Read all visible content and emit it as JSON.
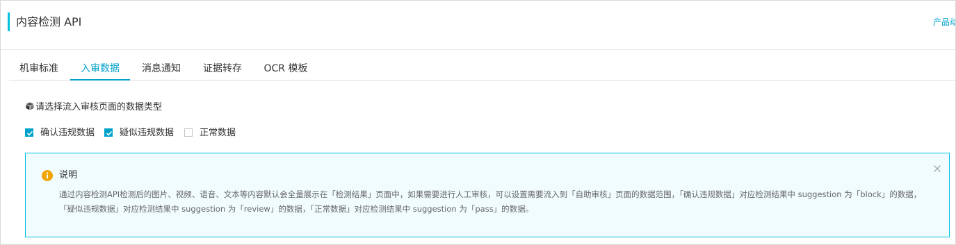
{
  "header": {
    "title": "内容检测 API",
    "product_link": "产品动"
  },
  "tabs": [
    {
      "label": "机审标准",
      "active": false
    },
    {
      "label": "入审数据",
      "active": true
    },
    {
      "label": "消息通知",
      "active": false
    },
    {
      "label": "证据转存",
      "active": false
    },
    {
      "label": "OCR 模板",
      "active": false
    }
  ],
  "section": {
    "icon": "cube-icon",
    "title": "请选择流入审核页面的数据类型"
  },
  "checkboxes": [
    {
      "label": "确认违规数据",
      "checked": true
    },
    {
      "label": "疑似违规数据",
      "checked": true
    },
    {
      "label": "正常数据",
      "checked": false
    }
  ],
  "notice": {
    "icon": "info-icon",
    "title": "说明",
    "text": "通过内容检测API检测后的图片、视频、语音、文本等内容默认会全量展示在「检测结果」页面中，如果需要进行人工审核，可以设置需要流入到「自助审核」页面的数据范围，「确认违规数据」对应检测结果中 suggestion 为「block」的数据，「疑似违规数据」对应检测结果中 suggestion 为「review」的数据，「正常数据」对应检测结果中 suggestion 为「pass」的数据。"
  },
  "colors": {
    "accent": "#00a2ca",
    "notice_border": "#00c1de",
    "notice_bg": "#f1fcff"
  }
}
